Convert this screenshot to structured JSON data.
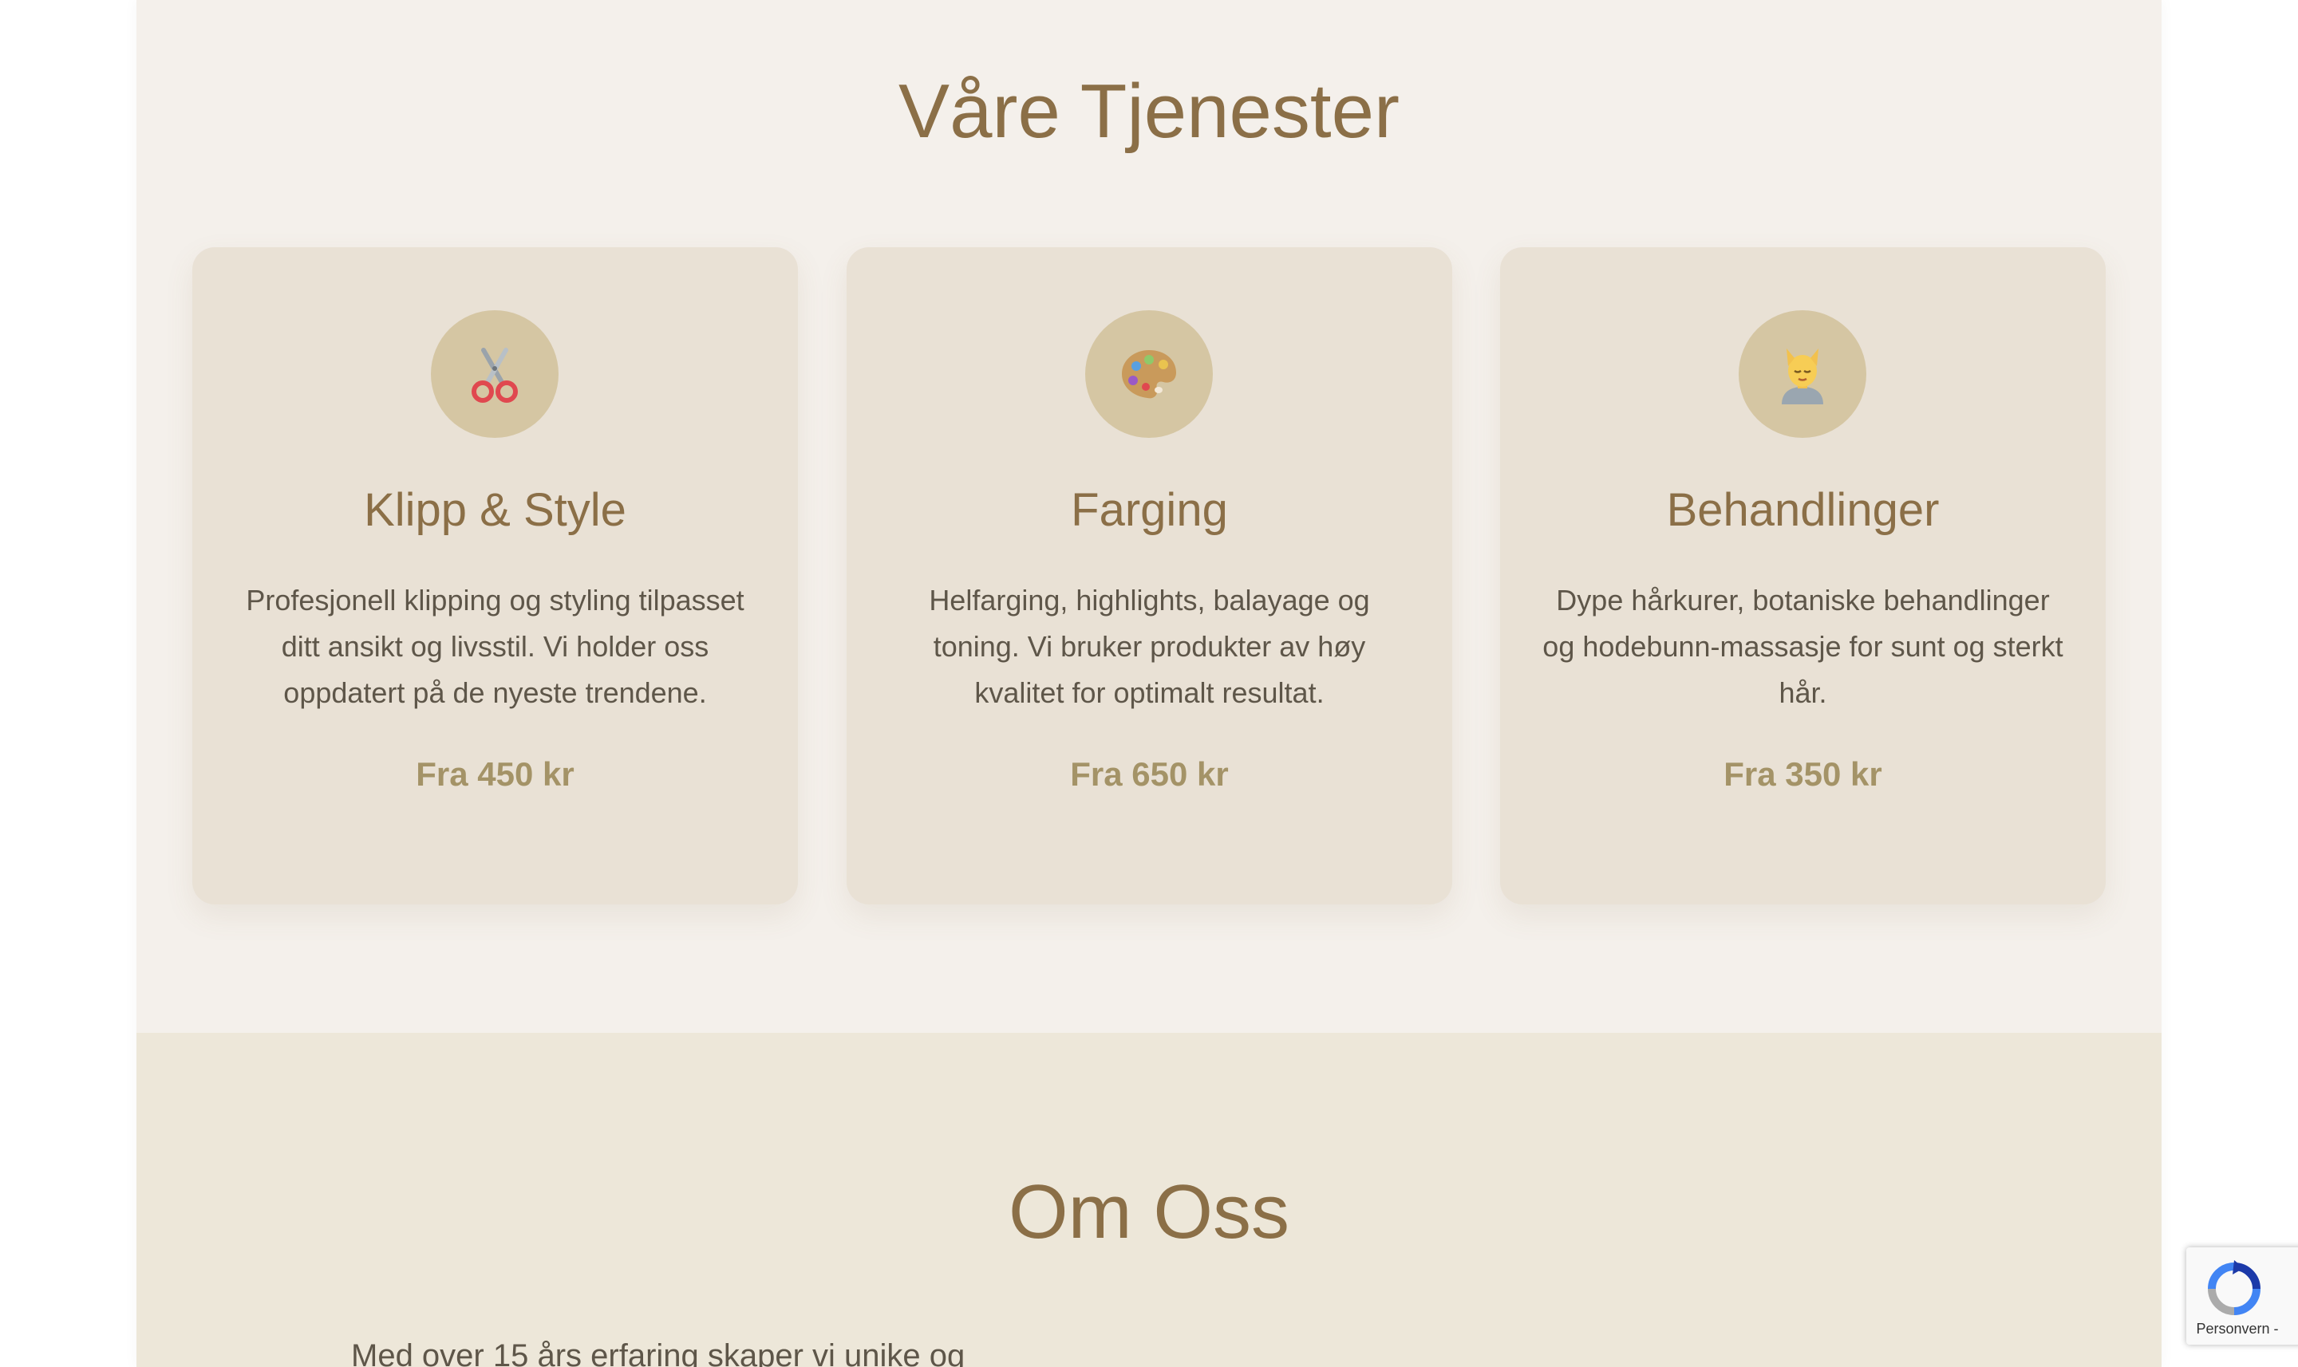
{
  "services": {
    "title": "Våre Tjenester",
    "cards": [
      {
        "icon": "scissors-icon",
        "title": "Klipp & Style",
        "description": "Profesjonell klipping og styling tilpasset ditt ansikt og livsstil. Vi holder oss oppdatert på de nyeste trendene.",
        "price": "Fra 450 kr"
      },
      {
        "icon": "palette-icon",
        "title": "Farging",
        "description": "Helfarging, highlights, balayage og toning. Vi bruker produkter av høy kvalitet for optimalt resultat.",
        "price": "Fra 650 kr"
      },
      {
        "icon": "face-massage-icon",
        "title": "Behandlinger",
        "description": "Dype hårkurer, botaniske behandlinger og hodebunn-massasje for sunt og sterkt hår.",
        "price": "Fra 350 kr"
      }
    ]
  },
  "about": {
    "title": "Om Oss",
    "text": "Med over 15 års erfaring skaper vi unike og"
  },
  "recaptcha": {
    "label": "Personvern -"
  },
  "colors": {
    "accent_brown": "#8b6f47",
    "price_gold": "#a49367",
    "card_bg": "#e9e1d5",
    "icon_circle": "#d5c6a3",
    "services_bg": "#f4f0eb",
    "about_bg": "#ede7d9"
  }
}
